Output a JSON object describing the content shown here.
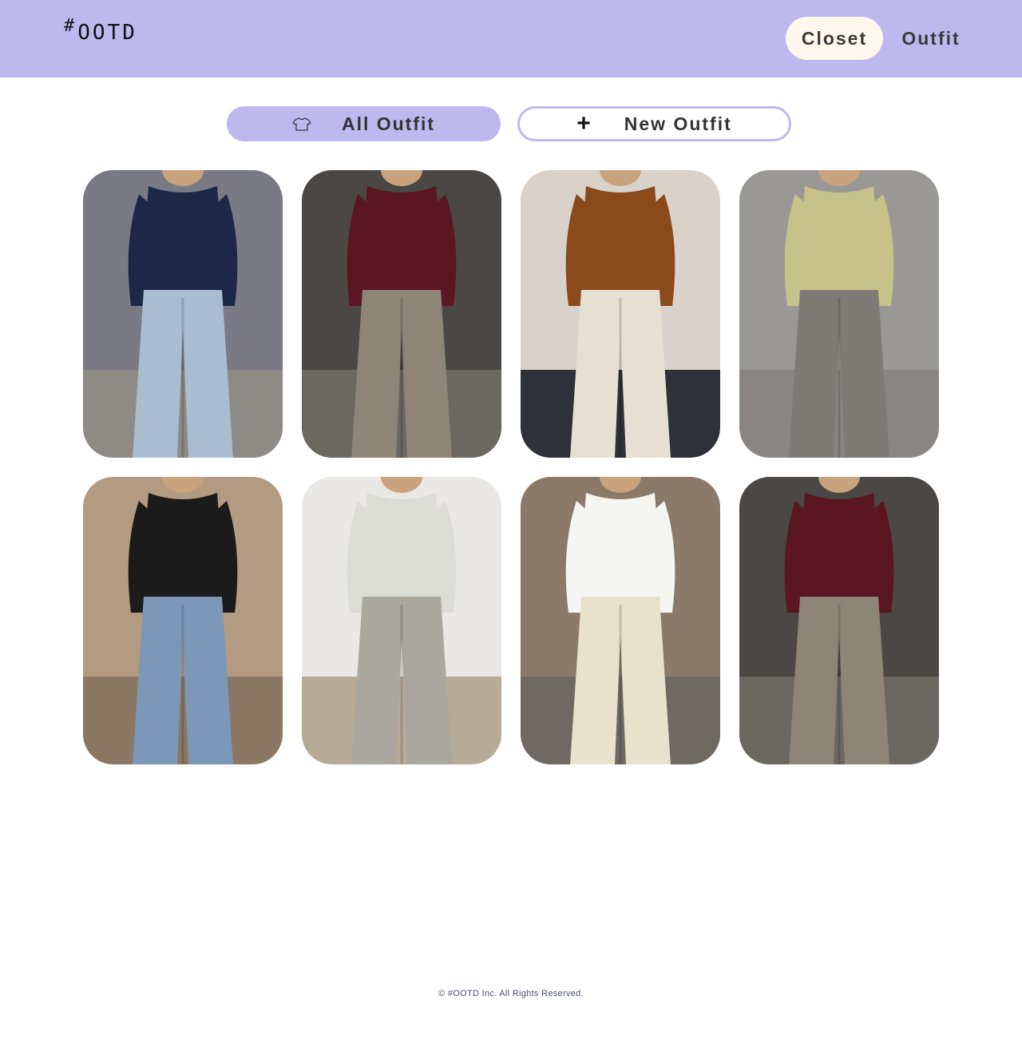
{
  "header": {
    "logo_hash": "#",
    "logo_text": "OOTD",
    "nav": {
      "closet": "Closet",
      "outfit": "Outfit"
    },
    "background_color": "#bdb8ee",
    "active_pill_color": "#fff6ec"
  },
  "tabs": {
    "all_outfit": {
      "label": "All Outfit",
      "icon": "tshirt-icon"
    },
    "new_outfit": {
      "label": "New Outfit",
      "icon": "plus-icon"
    }
  },
  "outfits": [
    {
      "name": "outfit-jersey-jeans",
      "top_color": "#1d2747",
      "bottom_color": "#a9bcd0",
      "bg_color": "#7a7a86",
      "ground_color": "#8e8a85"
    },
    {
      "name": "outfit-burgundy-cargo",
      "top_color": "#5a1622",
      "bottom_color": "#8e8577",
      "bg_color": "#4a4744",
      "ground_color": "#6b6761"
    },
    {
      "name": "outfit-brown-sweatshirt",
      "top_color": "#8a4a1c",
      "bottom_color": "#e6e0d2",
      "bg_color": "#d8d2ca",
      "ground_color": "#2e3238"
    },
    {
      "name": "outfit-vest-grey-trousers",
      "top_color": "#c7c28a",
      "bottom_color": "#7e7b76",
      "bg_color": "#9a9894",
      "ground_color": "#888582"
    },
    {
      "name": "outfit-blazer-wide-jeans",
      "top_color": "#1b1b1b",
      "bottom_color": "#7b98b9",
      "bg_color": "#b39b82",
      "ground_color": "#8a7764"
    },
    {
      "name": "outfit-bodysuit-sweats",
      "top_color": "#dcdcd6",
      "bottom_color": "#a9a79e",
      "bg_color": "#e9e8e4",
      "ground_color": "#b7ab98"
    },
    {
      "name": "outfit-striped-shirt-shorts",
      "top_color": "#f5f5f2",
      "bottom_color": "#e8e1cc",
      "bg_color": "#8b7a6a",
      "ground_color": "#6e6a63"
    },
    {
      "name": "outfit-burgundy-cargo-2",
      "top_color": "#5a1622",
      "bottom_color": "#8e8577",
      "bg_color": "#4a4744",
      "ground_color": "#6b6761"
    }
  ],
  "footer": {
    "text": "© #OOTD Inc. All Rights Reserved."
  }
}
